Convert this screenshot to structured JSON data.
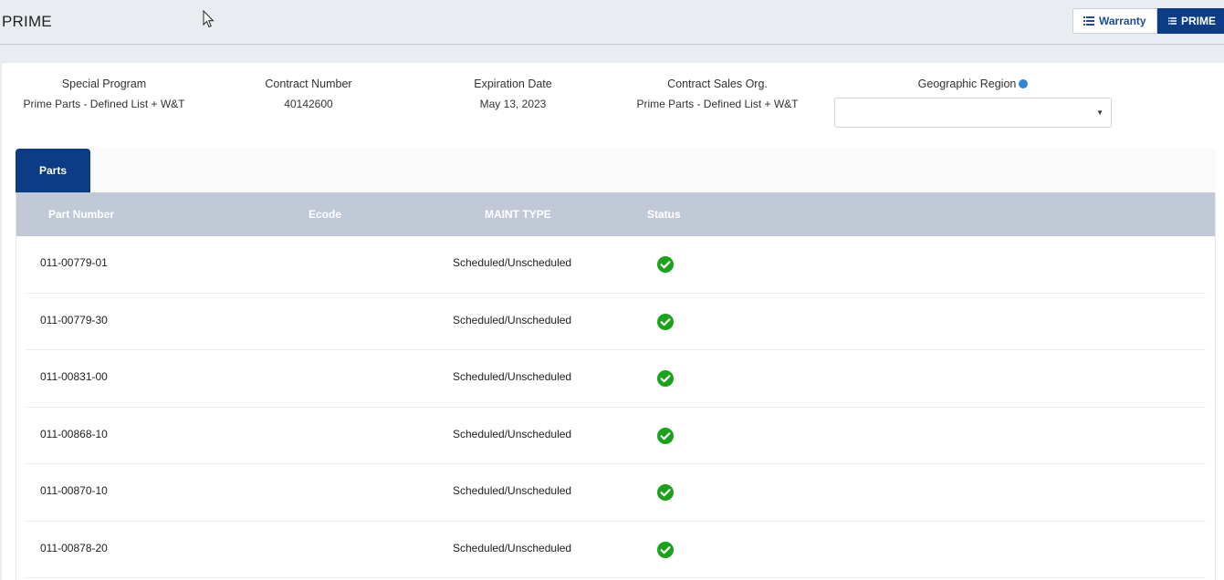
{
  "header": {
    "title": "PRIME",
    "toggles": [
      {
        "label": "Warranty",
        "icon": "list-icon"
      },
      {
        "label": "PRIME",
        "icon": "list-icon",
        "active": true
      }
    ]
  },
  "info": {
    "special_program": {
      "label": "Special Program",
      "value": "Prime Parts - Defined List + W&T"
    },
    "contract_number": {
      "label": "Contract Number",
      "value": "40142600"
    },
    "expiration_date": {
      "label": "Expiration Date",
      "value": "May 13, 2023"
    },
    "contract_sales_org": {
      "label": "Contract Sales Org.",
      "value": "Prime Parts - Defined List + W&T"
    },
    "geographic_region": {
      "label": "Geographic Region",
      "icon": "globe-icon",
      "value": ""
    }
  },
  "tabs": [
    {
      "label": "Parts",
      "active": true
    }
  ],
  "table": {
    "columns": [
      "Part Number",
      "Ecode",
      "MAINT TYPE",
      "Status"
    ],
    "rows": [
      {
        "part_number": "011-00779-01",
        "ecode": "",
        "maint_type": "Scheduled/Unscheduled",
        "status": "check-icon"
      },
      {
        "part_number": "011-00779-30",
        "ecode": "",
        "maint_type": "Scheduled/Unscheduled",
        "status": "check-icon"
      },
      {
        "part_number": "011-00831-00",
        "ecode": "",
        "maint_type": "Scheduled/Unscheduled",
        "status": "check-icon"
      },
      {
        "part_number": "011-00868-10",
        "ecode": "",
        "maint_type": "Scheduled/Unscheduled",
        "status": "check-icon"
      },
      {
        "part_number": "011-00870-10",
        "ecode": "",
        "maint_type": "Scheduled/Unscheduled",
        "status": "check-icon"
      },
      {
        "part_number": "011-00878-20",
        "ecode": "",
        "maint_type": "Scheduled/Unscheduled",
        "status": "check-icon"
      }
    ]
  },
  "colors": {
    "primary": "#0c3c86",
    "table_header": "#c2c9d6",
    "status_ok": "#1aa31a",
    "page_bg": "#e9edf2"
  }
}
